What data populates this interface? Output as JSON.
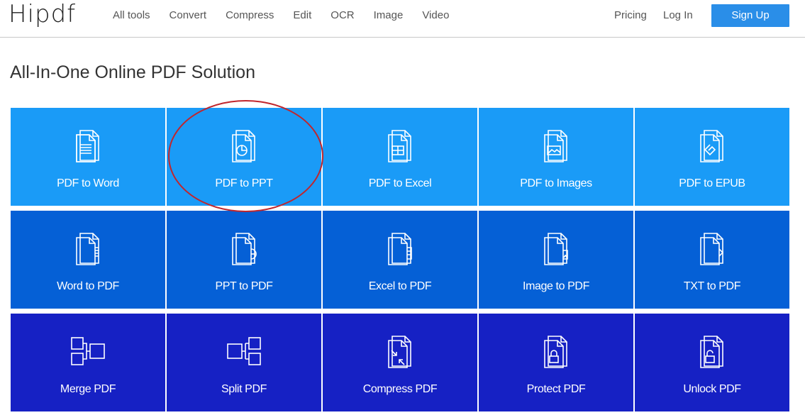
{
  "header": {
    "logo": "Hipdf",
    "nav": [
      "All tools",
      "Convert",
      "Compress",
      "Edit",
      "OCR",
      "Image",
      "Video"
    ],
    "pricing": "Pricing",
    "login": "Log In",
    "signup": "Sign Up"
  },
  "page_title": "All-In-One Online PDF Solution",
  "tools": {
    "row1": [
      {
        "label": "PDF to Word",
        "icon": "pdf-to-word-icon"
      },
      {
        "label": "PDF to PPT",
        "icon": "pdf-to-ppt-icon"
      },
      {
        "label": "PDF to Excel",
        "icon": "pdf-to-excel-icon"
      },
      {
        "label": "PDF to Images",
        "icon": "pdf-to-images-icon"
      },
      {
        "label": "PDF to EPUB",
        "icon": "pdf-to-epub-icon"
      }
    ],
    "row2": [
      {
        "label": "Word to PDF",
        "icon": "word-to-pdf-icon"
      },
      {
        "label": "PPT to PDF",
        "icon": "ppt-to-pdf-icon"
      },
      {
        "label": "Excel to PDF",
        "icon": "excel-to-pdf-icon"
      },
      {
        "label": "Image to PDF",
        "icon": "image-to-pdf-icon"
      },
      {
        "label": "TXT to PDF",
        "icon": "txt-to-pdf-icon"
      }
    ],
    "row3": [
      {
        "label": "Merge PDF",
        "icon": "merge-pdf-icon"
      },
      {
        "label": "Split PDF",
        "icon": "split-pdf-icon"
      },
      {
        "label": "Compress PDF",
        "icon": "compress-pdf-icon"
      },
      {
        "label": "Protect PDF",
        "icon": "protect-pdf-icon"
      },
      {
        "label": "Unlock PDF",
        "icon": "unlock-pdf-icon"
      }
    ]
  },
  "colors": {
    "row1": "#1a9bf7",
    "row2": "#0560d6",
    "row3": "#1621c4",
    "signup": "#2a8ee8",
    "highlight_circle": "#c0262d"
  }
}
